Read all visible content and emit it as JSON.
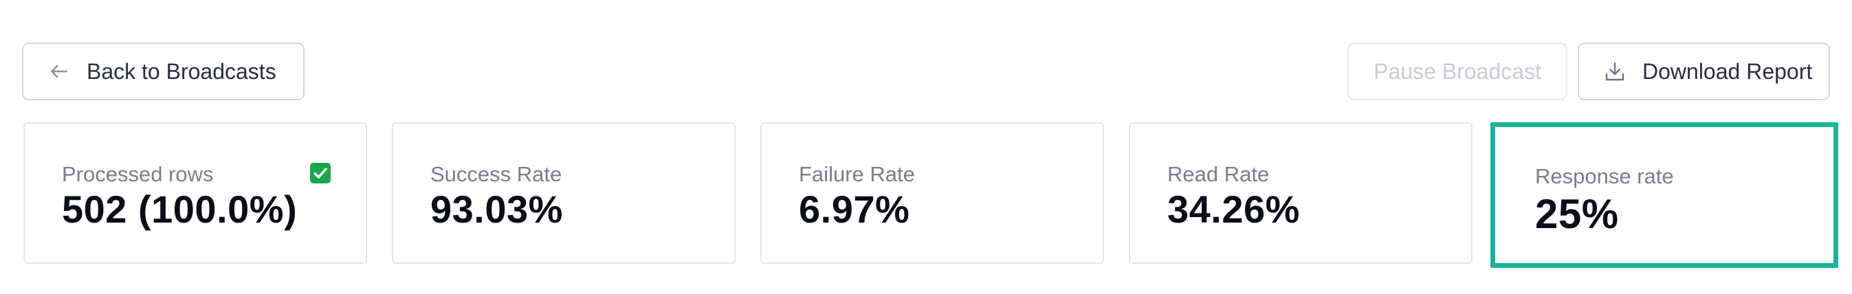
{
  "toolbar": {
    "back_label": "Back to Broadcasts",
    "pause_label": "Pause Broadcast",
    "download_label": "Download Report",
    "back_icon": "arrow-left-icon",
    "download_icon": "download-icon"
  },
  "stats": [
    {
      "label": "Processed rows",
      "value": "502 (100.0%)",
      "icon": "check-mark-icon",
      "icon_color": "#1aa64a"
    },
    {
      "label": "Success Rate",
      "value": "93.03%"
    },
    {
      "label": "Failure Rate",
      "value": "6.97%"
    },
    {
      "label": "Read Rate",
      "value": "34.26%"
    },
    {
      "label": "Response rate",
      "value": "25%",
      "highlight_color": "#19b39b"
    }
  ]
}
